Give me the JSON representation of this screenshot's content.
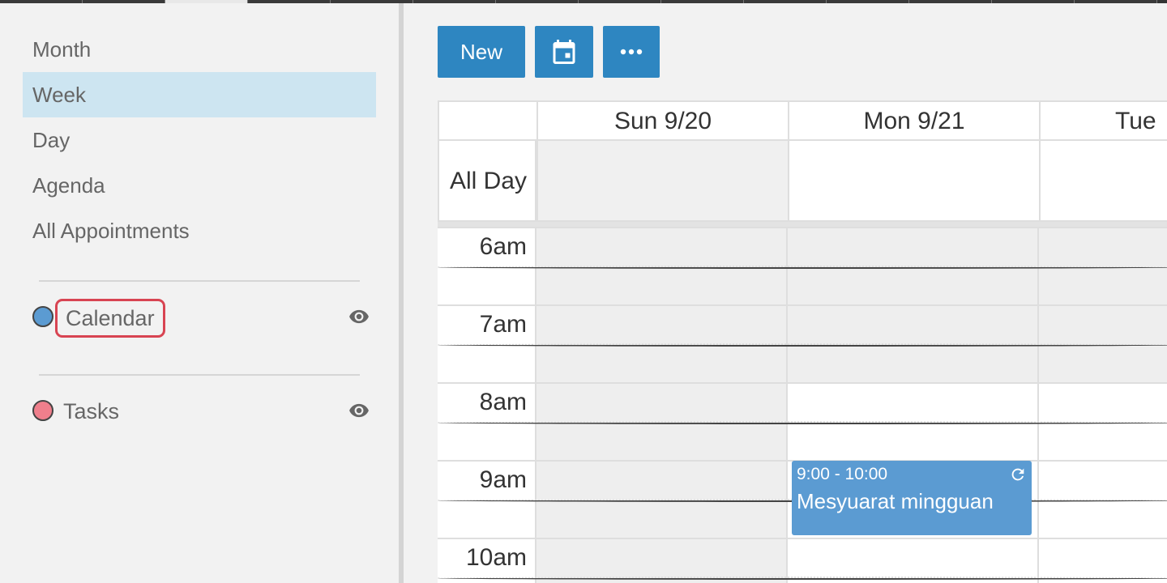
{
  "sidebar": {
    "views": [
      {
        "label": "Month",
        "selected": false
      },
      {
        "label": "Week",
        "selected": true
      },
      {
        "label": "Day",
        "selected": false
      },
      {
        "label": "Agenda",
        "selected": false
      },
      {
        "label": "All Appointments",
        "selected": false
      }
    ],
    "calendars": [
      {
        "label": "Calendar",
        "color": "#5b9bd2",
        "icon": "eye-icon"
      },
      {
        "label": "Tasks",
        "color": "#ef7f8c",
        "icon": "eye-icon"
      }
    ]
  },
  "toolbar": {
    "new_label": "New",
    "calendar_icon": "calendar-today-icon",
    "more_icon": "more-horizontal-icon"
  },
  "grid": {
    "days": [
      "Sun 9/20",
      "Mon 9/21",
      "Tue"
    ],
    "all_day_label": "All Day",
    "hours": [
      "6am",
      "7am",
      "8am",
      "9am",
      "10am"
    ]
  },
  "event": {
    "time": "9:00 - 10:00",
    "title": "Mesyuarat mingguan",
    "icon": "recurring-icon",
    "color": "#5b9bd2"
  },
  "colors": {
    "accent": "#2e86c1",
    "selected_view": "#cde5f1",
    "highlight_ring": "#d84452"
  }
}
